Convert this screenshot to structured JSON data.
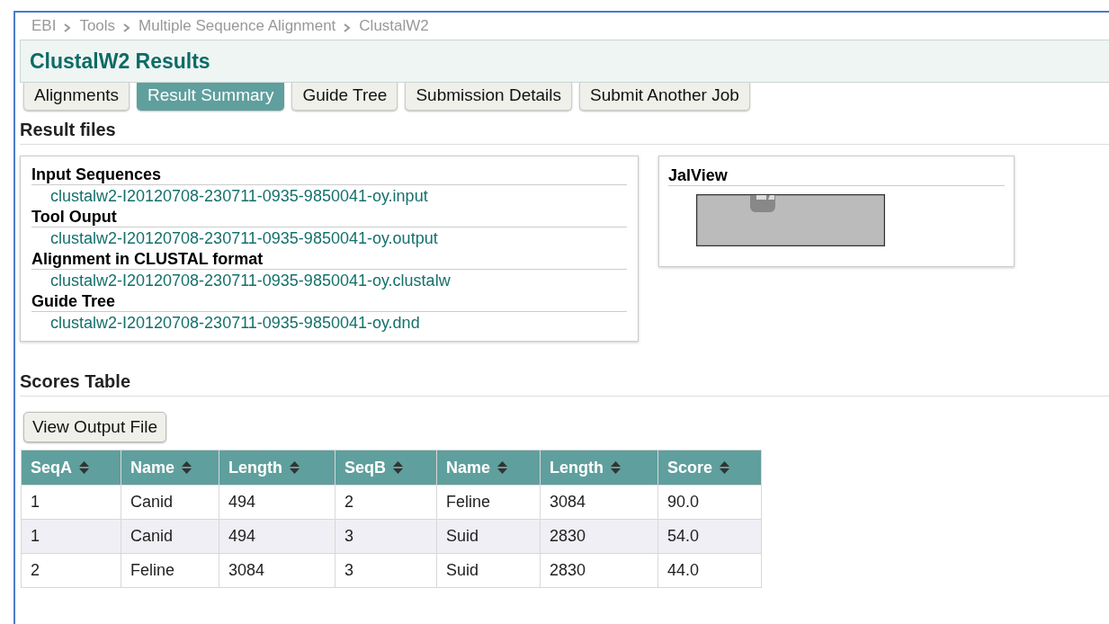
{
  "breadcrumb": [
    "EBI",
    "Tools",
    "Multiple Sequence Alignment",
    "ClustalW2"
  ],
  "title": "ClustalW2 Results",
  "tabs": [
    {
      "label": "Alignments",
      "selected": false
    },
    {
      "label": "Result Summary",
      "selected": true
    },
    {
      "label": "Guide Tree",
      "selected": false
    },
    {
      "label": "Submission Details",
      "selected": false
    },
    {
      "label": "Submit Another Job",
      "selected": false
    }
  ],
  "result_files": {
    "title": "Result files",
    "groups": [
      {
        "heading": "Input Sequences",
        "file": "clustalw2-I20120708-230711-0935-9850041-oy.input"
      },
      {
        "heading": "Tool Ouput",
        "file": "clustalw2-I20120708-230711-0935-9850041-oy.output"
      },
      {
        "heading": "Alignment in CLUSTAL format",
        "file": "clustalw2-I20120708-230711-0935-9850041-oy.clustalw"
      },
      {
        "heading": "Guide Tree",
        "file": "clustalw2-I20120708-230711-0935-9850041-oy.dnd"
      }
    ]
  },
  "jalview": {
    "title": "JalView"
  },
  "scores": {
    "title": "Scores Table",
    "button": "View Output File",
    "columns": [
      "SeqA",
      "Name",
      "Length",
      "SeqB",
      "Name",
      "Length",
      "Score"
    ],
    "rows": [
      [
        "1",
        "Canid",
        "494",
        "2",
        "Feline",
        "3084",
        "90.0"
      ],
      [
        "1",
        "Canid",
        "494",
        "3",
        "Suid",
        "2830",
        "54.0"
      ],
      [
        "2",
        "Feline",
        "3084",
        "3",
        "Suid",
        "2830",
        "44.0"
      ]
    ]
  }
}
